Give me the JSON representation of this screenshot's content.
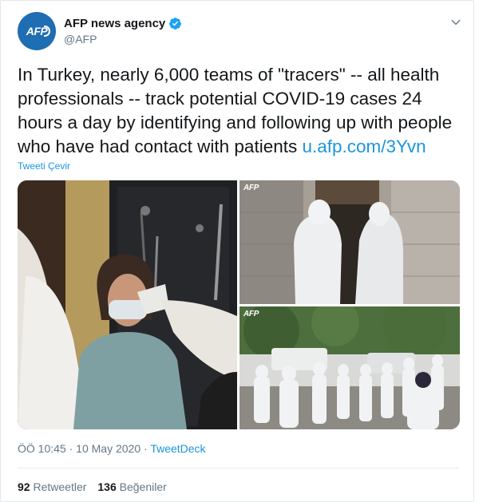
{
  "account": {
    "name": "AFP news agency",
    "handle": "@AFP",
    "avatar_text": "AFP",
    "brand_color": "#1f6db3",
    "verified_color": "#1da1f2"
  },
  "tweet": {
    "text": "In Turkey, nearly 6,000 teams of \"tracers\" -- all health professionals -- track potential COVID-19 cases 24 hours a day by identifying and following up with people who have had contact with patients ",
    "link": "u.afp.com/3Yvn",
    "translate_label": "Tweeti Çevir",
    "time": "ÖÖ 10:45",
    "date": "10 May 2020",
    "separator": "·",
    "source": "TweetDeck"
  },
  "media": {
    "watermark": "AFP",
    "images": [
      {
        "name": "photo-temperature-check"
      },
      {
        "name": "photo-tracers-doorway"
      },
      {
        "name": "photo-tracers-street"
      }
    ]
  },
  "stats": {
    "retweets_count": "92",
    "retweets_label": "Retweetler",
    "likes_count": "136",
    "likes_label": "Beğeniler"
  },
  "icons": {
    "verified": "verified-badge-icon",
    "caret": "chevron-down-icon"
  }
}
